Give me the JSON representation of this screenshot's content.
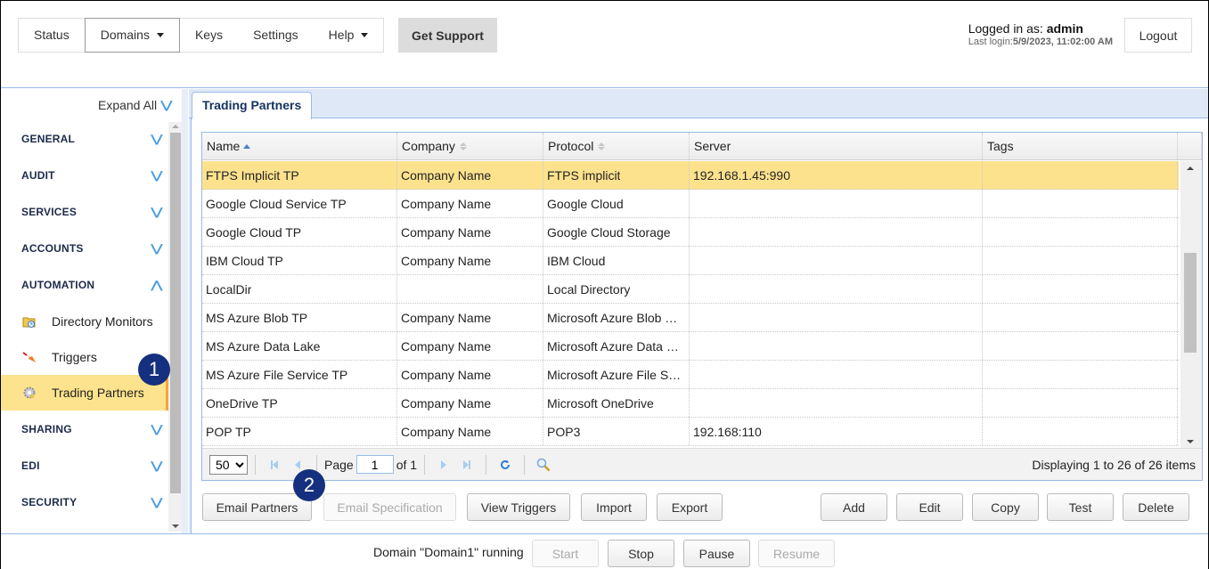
{
  "topnav": {
    "items": [
      {
        "label": "Status",
        "dropdown": false,
        "active": false
      },
      {
        "label": "Domains",
        "dropdown": true,
        "active": true
      },
      {
        "label": "Keys",
        "dropdown": false,
        "active": false
      },
      {
        "label": "Settings",
        "dropdown": false,
        "active": false
      },
      {
        "label": "Help",
        "dropdown": true,
        "active": false
      }
    ],
    "support_label": "Get Support"
  },
  "user": {
    "logged_in_prefix": "Logged in as: ",
    "username": "admin",
    "last_login_prefix": "Last login:",
    "last_login_date": "5/9/2023, ",
    "last_login_time": "11:02:00 AM",
    "logout_label": "Logout"
  },
  "sidebar": {
    "expand_all_label": "Expand All",
    "sections": [
      {
        "label": "GENERAL",
        "expanded": false
      },
      {
        "label": "AUDIT",
        "expanded": false
      },
      {
        "label": "SERVICES",
        "expanded": false
      },
      {
        "label": "ACCOUNTS",
        "expanded": false
      },
      {
        "label": "AUTOMATION",
        "expanded": true
      },
      {
        "label": "SHARING",
        "expanded": false
      },
      {
        "label": "EDI",
        "expanded": false
      },
      {
        "label": "SECURITY",
        "expanded": false
      }
    ],
    "automation_items": [
      {
        "label": "Directory Monitors",
        "icon": "folder-clock-icon",
        "selected": false
      },
      {
        "label": "Triggers",
        "icon": "trigger-arrow-icon",
        "selected": false
      },
      {
        "label": "Trading Partners",
        "icon": "gear-icon",
        "selected": true
      }
    ]
  },
  "callouts": [
    "1",
    "2"
  ],
  "main": {
    "tab_label": "Trading Partners",
    "columns": [
      {
        "label": "Name",
        "sort": "asc"
      },
      {
        "label": "Company",
        "sort": "none"
      },
      {
        "label": "Protocol",
        "sort": "none"
      },
      {
        "label": "Server",
        "sort": "off"
      },
      {
        "label": "Tags",
        "sort": "off"
      }
    ],
    "rows": [
      {
        "name": "FTPS Implicit TP",
        "company": "Company Name",
        "protocol": "FTPS implicit",
        "server": "192.168.1.45:990",
        "tags": "",
        "selected": true
      },
      {
        "name": "Google Cloud Service TP",
        "company": "Company Name",
        "protocol": "Google Cloud",
        "server": "",
        "tags": ""
      },
      {
        "name": "Google Cloud TP",
        "company": "Company Name",
        "protocol": "Google Cloud Storage",
        "server": "",
        "tags": ""
      },
      {
        "name": "IBM Cloud TP",
        "company": "Company Name",
        "protocol": "IBM Cloud",
        "server": "",
        "tags": ""
      },
      {
        "name": "LocalDir",
        "company": "",
        "protocol": "Local Directory",
        "server": "",
        "tags": ""
      },
      {
        "name": "MS Azure Blob TP",
        "company": "Company Name",
        "protocol": "Microsoft Azure Blob Storage",
        "server": "",
        "tags": ""
      },
      {
        "name": "MS Azure Data Lake",
        "company": "Company Name",
        "protocol": "Microsoft Azure Data Lake",
        "server": "",
        "tags": ""
      },
      {
        "name": "MS Azure File Service TP",
        "company": "Company Name",
        "protocol": "Microsoft Azure File Service",
        "server": "",
        "tags": ""
      },
      {
        "name": "OneDrive TP",
        "company": "Company Name",
        "protocol": "Microsoft OneDrive",
        "server": "",
        "tags": ""
      },
      {
        "name": "POP TP",
        "company": "Company Name",
        "protocol": "POP3",
        "server": "192.168:110",
        "tags": ""
      }
    ],
    "pager": {
      "page_size": "50",
      "page_label": "Page",
      "page_value": "1",
      "of_label": "of 1",
      "display_text": "Displaying 1 to 26 of 26 items"
    },
    "actions": {
      "email_partners": "Email Partners",
      "email_specification": "Email Specification",
      "view_triggers": "View Triggers",
      "import": "Import",
      "export": "Export",
      "add": "Add",
      "edit": "Edit",
      "copy": "Copy",
      "test": "Test",
      "delete": "Delete"
    }
  },
  "footer": {
    "status": "Domain \"Domain1\" running",
    "start": "Start",
    "stop": "Stop",
    "pause": "Pause",
    "resume": "Resume"
  }
}
